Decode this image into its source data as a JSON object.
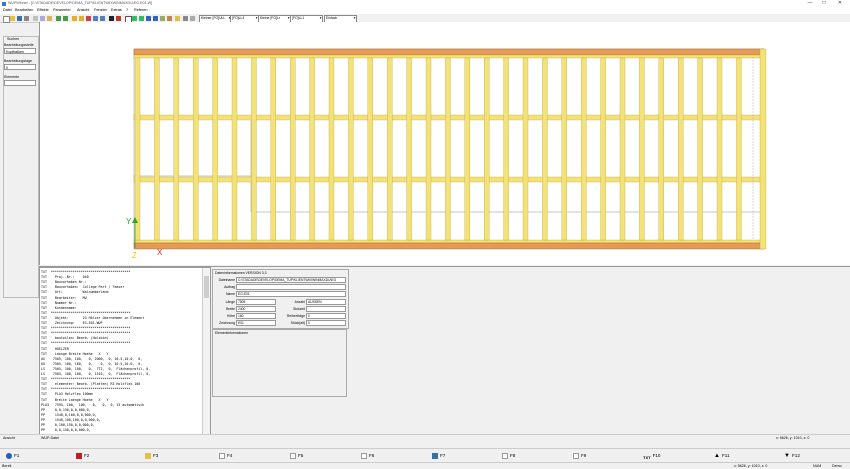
{
  "window": {
    "title": "WUPWinner - [C:\\STADADE\\DEVELOP\\DEMA_TUP\\KLIENT\\MIXWINMAXDU\\EG-E01-W]",
    "controls": [
      "—",
      "□",
      "✕"
    ]
  },
  "menu": [
    "Datei",
    "Bearbeiten",
    "Effekte",
    "Parameter",
    "Ansicht",
    "Fenster",
    "Extras",
    "?",
    "Referen"
  ],
  "toolbar": {
    "selects": [
      "Kleiner [FO]ULL",
      "[FO]LL4",
      "Kleine [FO]Lr",
      "[FO]LL1",
      "Einfach"
    ]
  },
  "left_panel": {
    "search_label": "Suchen",
    "level_label": "Bearbeitungsstelle",
    "level_value": "Kopfbalken",
    "layer_label": "Bearbeitungslage",
    "layer_value": "0",
    "element_label": "Elemente",
    "element_value": ""
  },
  "view": {
    "axis_y": "Y",
    "axis_x": "X",
    "axis_z": "Z"
  },
  "list_lines": [
    "TXT  ****************************************",
    "TXT    Proj.-Nr.:    040",
    "TXT    Bauvorhaben Nr.:",
    "TXT    Bauvorhaben:  College Part / Teaser",
    "TXT    Ort:          Walnumberland",
    "TXT    Bearbeiter:   MU",
    "TXT    Nummer Nr.:",
    "TXT    Kundenname:",
    "TXT  ****************************************",
    "TXT    Objekt:       2G Hölzer übernehmen in Element",
    "TXT    Zeichnung:    EG-E01-WUP",
    "TXT  ****************************************",
    "TXT  ****************************************",
    "TXT    bauteilen: Bearb. (Holzbim)",
    "TXT  ****************************************",
    "TXT    HOELZER",
    "TXT    Laenge Breite Hoehe   X   Y",
    "UG    7505, 100, 100,   0, 2000,  0, 10.5,10.0,  0,",
    "OG    7505, 100, 160,   0,    0,  0, 10.5,10.0,  0,",
    "LS    7505, 100, 100,   0,  772,  0,  Flächenprofil, 0,",
    "LS    7505, 100, 160,   0, 1510,  0,  Flächenprofil, 0,",
    "TXT  ****************************************",
    "TXT    elementer: Bearb. (Platten) R3 Holzflex 100",
    "TXT  ****************************************",
    "TXT    PLA3 Holzflex 100mm",
    "TXT    Breite Laenge Hoehe   X   Y",
    "PLA3   7595, 100,  100,   0,   0,  0, 15 automatisch",
    "PP     0,0,150,0,0,000,0,",
    "PP     1540,0,160,0,0,000,0,",
    "PP     1540,100,160,0,0,000,0,",
    "PP     0,100,150,0,0,000,0,",
    "PP     0,0,150,0,0,000,0,"
  ],
  "dateninfo": {
    "title": "Dateninformationen VERSION 3.3",
    "rows": [
      {
        "label": "Dateiname",
        "value": "C:\\STADADE\\DEVELOP\\DEMA_TUP\\KLIENT\\MIXWINMAXDU\\EG"
      },
      {
        "label": "Auftrag",
        "value": ""
      },
      {
        "label": "Name",
        "value": "EG-E01"
      },
      {
        "label": "Länge",
        "value": "7505"
      },
      {
        "label": "Breite",
        "value": "2400"
      },
      {
        "label": "Höhe",
        "value": "160"
      },
      {
        "label": "Zeichnung",
        "value": "E01"
      }
    ],
    "right_rows": [
      {
        "label": "Anzahl",
        "value": "AUSSEN"
      },
      {
        "label": "Stckzeit",
        "value": ""
      },
      {
        "label": "Reihenfolge",
        "value": "0"
      },
      {
        "label": "Stück(alt)",
        "value": "0"
      }
    ]
  },
  "elementinfo_title": "Elementinformationen",
  "status": {
    "left": "Ansicht",
    "mid": "WUP-Datei",
    "right": "x: 5626, y: 1010, z: 0"
  },
  "fkeys": [
    {
      "key": "F1",
      "icon": "help-icon",
      "color": "#1f5fbf"
    },
    {
      "key": "F2",
      "icon": "stop-icon",
      "color": "#c02020"
    },
    {
      "key": "F3",
      "icon": "folder-icon",
      "color": "#e6c040"
    },
    {
      "key": "F4",
      "icon": "blank-icon",
      "color": "#ffffff"
    },
    {
      "key": "F5",
      "icon": "blank-icon",
      "color": "#ffffff"
    },
    {
      "key": "F6",
      "icon": "blank-icon",
      "color": "#ffffff"
    },
    {
      "key": "F7",
      "icon": "save-icon",
      "color": "#3a6ea5"
    },
    {
      "key": "F8",
      "icon": "blank-icon",
      "color": "#ffffff"
    },
    {
      "key": "F9",
      "icon": "blank-icon",
      "color": "#ffffff"
    },
    {
      "key": "F10",
      "icon": "txt-icon",
      "color": "#000000",
      "prefix": "TXT"
    },
    {
      "key": "F11",
      "icon": "arrow-up-icon",
      "color": "#000000"
    },
    {
      "key": "F12",
      "icon": "arrow-down-icon",
      "color": "#000000"
    }
  ],
  "footer": {
    "left": "Bereit",
    "coords": "x: 5626, y: 1010, z: 0",
    "num": "NUM",
    "demo": "Demo"
  },
  "colors": {
    "timber_fill": "#f3e27a",
    "timber_edge": "#b89a1c",
    "plate_fill": "#e59a55",
    "plate_edge": "#9a5a20",
    "axis_y": "#22aa22",
    "axis_x": "#dd2222",
    "axis_z": "#e6c800"
  }
}
